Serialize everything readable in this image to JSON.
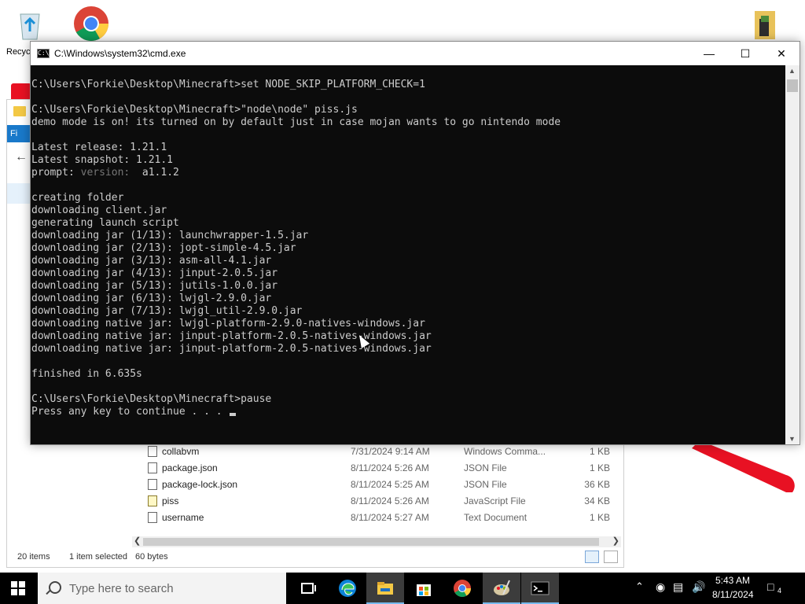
{
  "desktop": {
    "recycle_label": "Recyc"
  },
  "cmd": {
    "title": "C:\\Windows\\system32\\cmd.exe",
    "lines": [
      "C:\\Users\\Forkie\\Desktop\\Minecraft>set NODE_SKIP_PLATFORM_CHECK=1",
      "",
      "C:\\Users\\Forkie\\Desktop\\Minecraft>\"node\\node\" piss.js",
      "demo mode is on! its turned on by default just in case mojan wants to go nintendo mode",
      "",
      "Latest release: 1.21.1",
      "Latest snapshot: 1.21.1",
      "",
      "",
      "creating folder",
      "downloading client.jar",
      "generating launch script",
      "downloading jar (1/13): launchwrapper-1.5.jar",
      "downloading jar (2/13): jopt-simple-4.5.jar",
      "downloading jar (3/13): asm-all-4.1.jar",
      "downloading jar (4/13): jinput-2.0.5.jar",
      "downloading jar (5/13): jutils-1.0.0.jar",
      "downloading jar (6/13): lwjgl-2.9.0.jar",
      "downloading jar (7/13): lwjgl_util-2.9.0.jar",
      "downloading native jar: lwjgl-platform-2.9.0-natives-windows.jar",
      "downloading native jar: jinput-platform-2.0.5-natives-windows.jar",
      "downloading native jar: jinput-platform-2.0.5-natives-windows.jar",
      "",
      "finished in 6.635s",
      "",
      "C:\\Users\\Forkie\\Desktop\\Minecraft>pause",
      "Press any key to continue . . . "
    ],
    "prompt_label": "prompt:",
    "prompt_dim": "version:",
    "prompt_value": " a1.1.2"
  },
  "explorer": {
    "file_tab": "Fi",
    "files": [
      {
        "name": "collabvm",
        "date": "7/31/2024 9:14 AM",
        "type": "Windows Comma...",
        "size": "1 KB"
      },
      {
        "name": "package.json",
        "date": "8/11/2024 5:26 AM",
        "type": "JSON File",
        "size": "1 KB"
      },
      {
        "name": "package-lock.json",
        "date": "8/11/2024 5:25 AM",
        "type": "JSON File",
        "size": "36 KB"
      },
      {
        "name": "piss",
        "date": "8/11/2024 5:26 AM",
        "type": "JavaScript File",
        "size": "34 KB"
      },
      {
        "name": "username",
        "date": "8/11/2024 5:27 AM",
        "type": "Text Document",
        "size": "1 KB"
      }
    ],
    "status": {
      "items": "20 items",
      "selected": "1 item selected",
      "bytes": "60 bytes"
    }
  },
  "taskbar": {
    "search_placeholder": "Type here to search",
    "time": "5:43 AM",
    "date": "8/11/2024",
    "notification_count": "4",
    "icons": [
      "task-view-icon",
      "edge-icon",
      "file-explorer-icon",
      "store-icon",
      "chrome-icon",
      "paint-icon",
      "cmd-icon"
    ]
  }
}
